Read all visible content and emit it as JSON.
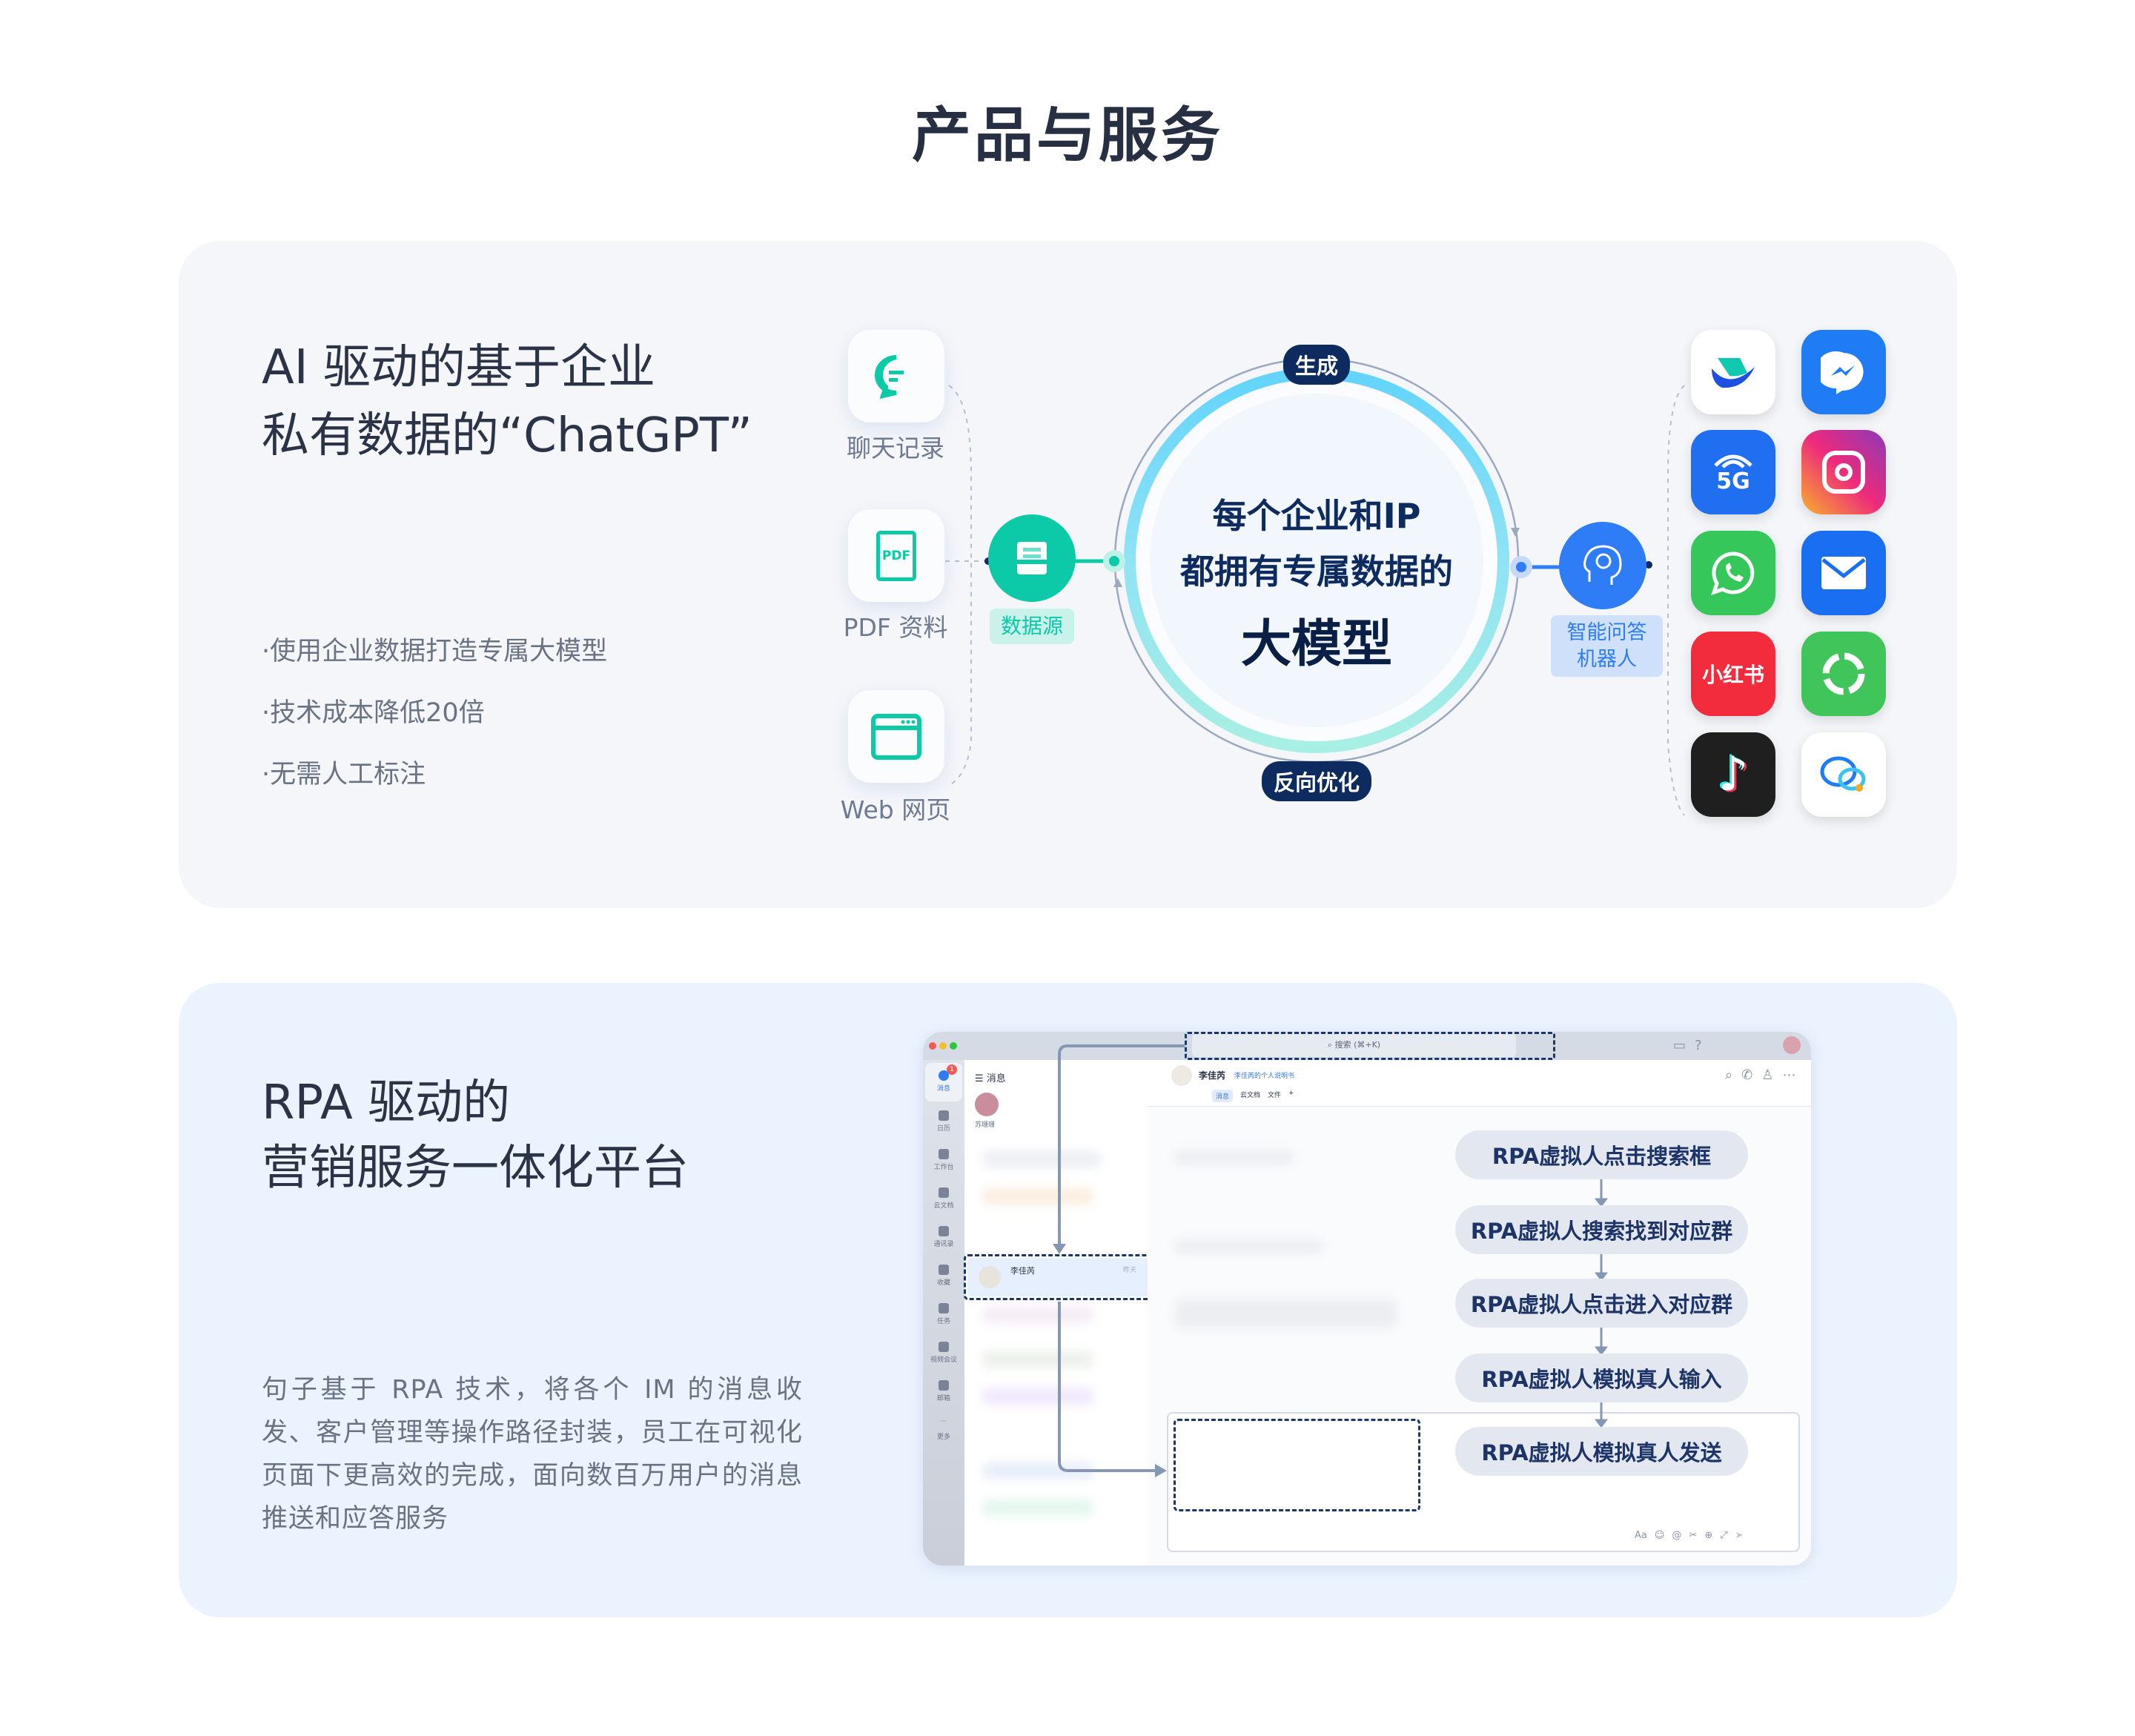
{
  "page_title": "产品与服务",
  "section1": {
    "heading_line1": "AI 驱动的基于企业",
    "heading_line2": "私有数据的“ChatGPT”",
    "bullets": [
      "·使用企业数据打造专属大模型",
      "·技术成本降低20倍",
      "·无需人工标注"
    ],
    "sources": [
      {
        "label": "聊天记录",
        "icon": "chat-bubble-icon"
      },
      {
        "label": "PDF 资料",
        "icon": "pdf-file-icon",
        "glyph": "PDF"
      },
      {
        "label": "Web 网页",
        "icon": "browser-window-icon"
      }
    ],
    "datasource_label": "数据源",
    "cycle_top": "生成",
    "cycle_bottom": "反向优化",
    "center_line1": "每个企业和IP",
    "center_line2": "都拥有专属数据的",
    "center_line3": "大模型",
    "robot_label_line1": "智能问答",
    "robot_label_line2": "机器人",
    "apps": [
      {
        "name": "lark-icon",
        "color": "#ffffff"
      },
      {
        "name": "messenger-icon",
        "color": "#1f7cf5"
      },
      {
        "name": "5g-icon",
        "color": "#1f6ff0",
        "glyph": "5G"
      },
      {
        "name": "instagram-icon",
        "color": "#e8306e"
      },
      {
        "name": "whatsapp-icon",
        "color": "#35c759"
      },
      {
        "name": "mail-icon",
        "color": "#1a6ef2"
      },
      {
        "name": "xiaohongshu-icon",
        "color": "#f22b3d",
        "glyph": "小红书"
      },
      {
        "name": "green-swirl-icon",
        "color": "#3fc55a"
      },
      {
        "name": "tiktok-icon",
        "color": "#1f1f1f"
      },
      {
        "name": "chat-bubbles-icon",
        "color": "#ffffff"
      }
    ],
    "colors": {
      "teal": "#0ccaa8",
      "blue": "#2e7cf6",
      "navy": "#0d2b5e"
    }
  },
  "section2": {
    "heading_line1": "RPA 驱动的",
    "heading_line2": "营销服务一体化平台",
    "paragraph": "句子基于 RPA 技术，将各个 IM 的消息收发、客户管理等操作路径封装，员工在可视化页面下更高效的完成，面向数百万用户的消息推送和应答服务",
    "app": {
      "search_placeholder": "搜索 (⌘+K)",
      "sidebar": [
        "消息",
        "日历",
        "工作台",
        "云文档",
        "通讯录",
        "收藏",
        "任务",
        "视频会议",
        "邮箱",
        "更多"
      ],
      "list_title": "消息",
      "pinned_contact": "苏珊珊",
      "conversation": {
        "name": "李佳芮",
        "time": "昨天"
      },
      "chat_name": "李佳芮",
      "chat_doc_link": "李佳芮的个人说明书",
      "chat_tabs": [
        "消息",
        "云文档",
        "文件",
        "+"
      ],
      "badge": "1",
      "input_tools": [
        "Aa",
        "☺",
        "@",
        "✂",
        "⊕",
        "⤢",
        "➤"
      ]
    },
    "rpa_steps": [
      "RPA虚拟人点击搜索框",
      "RPA虚拟人搜索找到对应群",
      "RPA虚拟人点击进入对应群",
      "RPA虚拟人模拟真人输入",
      "RPA虚拟人模拟真人发送"
    ]
  }
}
